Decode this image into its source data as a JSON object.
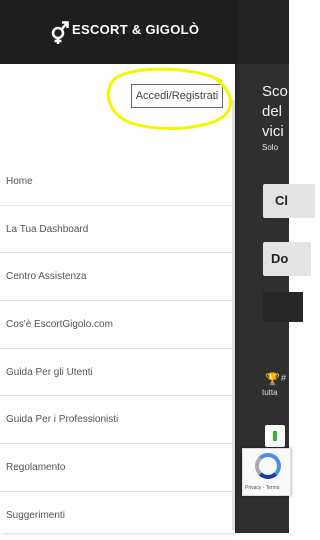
{
  "header": {
    "brand": "ESCORT & GIGOLÒ",
    "menu_icon": "hamburger-icon"
  },
  "login": {
    "label": "Accedi/Registrati"
  },
  "nav": {
    "items": [
      {
        "label": "Home"
      },
      {
        "label": "La Tua Dashboard"
      },
      {
        "label": "Centro Assistenza"
      },
      {
        "label": "Cos'è EscortGigolo.com"
      },
      {
        "label": "Guida Per gli Utenti"
      },
      {
        "label": "Guida Per i Professionisti"
      },
      {
        "label": "Regolamento"
      },
      {
        "label": "Suggerimenti"
      }
    ]
  },
  "background_page": {
    "hero_lines": [
      "Sco",
      "del",
      "vici"
    ],
    "hero_sub": "Solo",
    "button1": "Cl",
    "button2": "Do",
    "trophy_text": "#",
    "trophy_sub": "tutta",
    "recaptcha_text": "Privacy - Terms"
  },
  "colors": {
    "header_bg": "#1e1e1e",
    "page_bg": "#2f2f2f",
    "highlight": "#f5f500",
    "login_border": "#666666"
  }
}
